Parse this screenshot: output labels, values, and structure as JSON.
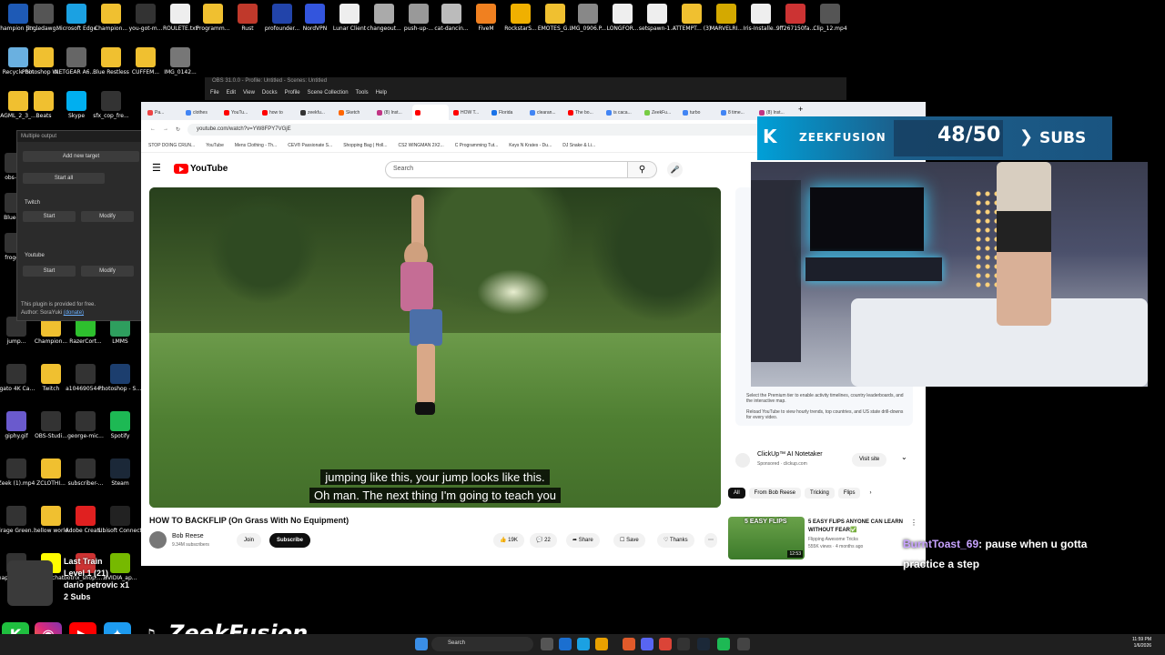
{
  "desktop": {
    "icons": [
      {
        "label": "Champion Stream Ov...",
        "color": "#1e5ab6"
      },
      {
        "label": "jingledawg...",
        "color": "#555"
      },
      {
        "label": "Microsoft Edge",
        "color": "#1ba1e2"
      },
      {
        "label": "Champion...",
        "color": "#f0c030"
      },
      {
        "label": "you-got-m...",
        "color": "#333"
      },
      {
        "label": "ROULETE.txt",
        "color": "#eee"
      },
      {
        "label": "Programm...",
        "color": "#f0c030"
      },
      {
        "label": "Rust",
        "color": "#c0392b"
      },
      {
        "label": "profounder...",
        "color": "#2244aa"
      },
      {
        "label": "NordVPN",
        "color": "#3355dd"
      },
      {
        "label": "Lunar Client",
        "color": "#eee"
      },
      {
        "label": "changeout...",
        "color": "#aaa"
      },
      {
        "label": "push-up-...",
        "color": "#999"
      },
      {
        "label": "cat-dancin...",
        "color": "#bbb"
      },
      {
        "label": "FiveM",
        "color": "#f08020"
      },
      {
        "label": "RockstarS...",
        "color": "#f0b000"
      },
      {
        "label": "EMOTES_G...",
        "color": "#f0c030"
      },
      {
        "label": "IMG_0906.P...",
        "color": "#888"
      },
      {
        "label": "LONGFOR...",
        "color": "#eee"
      },
      {
        "label": "setspawn-1...",
        "color": "#eee"
      },
      {
        "label": "ATTEMPT... (3)",
        "color": "#f0c030"
      },
      {
        "label": "MARVELRI...",
        "color": "#d4a900"
      },
      {
        "label": "Iris-Installe...",
        "color": "#eee"
      },
      {
        "label": "9ff267150fa...",
        "color": "#c33"
      },
      {
        "label": "Clip_12.mp4",
        "color": "#555"
      },
      {
        "label": "Recycle Bin",
        "color": "#6ab0e0"
      },
      {
        "label": "Photoshop Work",
        "color": "#f0c030"
      },
      {
        "label": "NETGEAR A6210 Genie",
        "color": "#666"
      },
      {
        "label": "Blue Restless",
        "color": "#f0c030"
      },
      {
        "label": "CUFFEM...",
        "color": "#f0c030"
      },
      {
        "label": "IMG_0142...",
        "color": "#777"
      },
      {
        "label": "AGML_2_3_...",
        "color": "#f0c030"
      },
      {
        "label": "Beats",
        "color": "#f0c030"
      },
      {
        "label": "Skype",
        "color": "#00aff0"
      },
      {
        "label": "sfx_cop_fre...",
        "color": "#333"
      },
      {
        "label": "obs-s...",
        "color": "#333"
      },
      {
        "label": "Blue-F...",
        "color": "#333"
      },
      {
        "label": "frogg...",
        "color": "#333"
      },
      {
        "label": "jump...",
        "color": "#333"
      },
      {
        "label": "Champion...",
        "color": "#f0c030"
      },
      {
        "label": "RazerCort...",
        "color": "#2ec02e"
      },
      {
        "label": "LMMS",
        "color": "#2e9e5e"
      },
      {
        "label": "Elgato 4K Captur...",
        "color": "#333"
      },
      {
        "label": "Twitch",
        "color": "#f0c030"
      },
      {
        "label": "a104690544...",
        "color": "#333"
      },
      {
        "label": "Photoshop - Shortcut",
        "color": "#1c3e6e"
      },
      {
        "label": "giphy.gif",
        "color": "#6a5acd"
      },
      {
        "label": "OBS-Studi...",
        "color": "#333"
      },
      {
        "label": "george-mic...",
        "color": "#333"
      },
      {
        "label": "Spotify",
        "color": "#1db954"
      },
      {
        "label": "Zeek (1).mp4",
        "color": "#333"
      },
      {
        "label": "ZCLOTHI...",
        "color": "#f0c030"
      },
      {
        "label": "subscriber-...",
        "color": "#333"
      },
      {
        "label": "Steam",
        "color": "#1b2838"
      },
      {
        "label": "Mirage Green Gaming Str...",
        "color": "#333"
      },
      {
        "label": "hellow world",
        "color": "#f0c030"
      },
      {
        "label": "Adobe Creati...",
        "color": "#e02020"
      },
      {
        "label": "Ubisoft Connect",
        "color": "#222"
      },
      {
        "label": "Snapchat botrix_shop...",
        "color": "#333"
      },
      {
        "label": "Snapchat",
        "color": "#fffc00"
      },
      {
        "label": "botrix_shop... PM.pdf",
        "color": "#c33"
      },
      {
        "label": "NVIDIA_ap...",
        "color": "#76b900"
      },
      {
        "label": "2024-04-15...",
        "color": "#555"
      },
      {
        "label": "Epic Games",
        "color": "#222"
      },
      {
        "label": "Invoice01.pdf",
        "color": "#c33"
      },
      {
        "label": "9f21ebb988...",
        "color": "#c33"
      },
      {
        "label": "NVIDIA App",
        "color": "#76b900"
      }
    ]
  },
  "multiple_output": {
    "title": "Multiple output",
    "add_target": "Add new target",
    "start_all": "Start all",
    "targets": [
      {
        "name": "Twitch",
        "start": "Start",
        "modify": "Modify"
      },
      {
        "name": "Youtube",
        "start": "Start",
        "modify": "Modify"
      }
    ],
    "note": "This plugin is provided for free.",
    "author": "Author: SoraYuki",
    "donate": "(donate)"
  },
  "obs": {
    "title": "OBS 31.0.0 - Profile: Untitled - Scenes: Untitled",
    "menu": [
      "File",
      "Edit",
      "View",
      "Docks",
      "Profile",
      "Scene Collection",
      "Tools",
      "Help"
    ]
  },
  "browser": {
    "tabs": [
      {
        "label": "Pa...",
        "color": "#e44"
      },
      {
        "label": "clothes",
        "color": "#4285f4"
      },
      {
        "label": "YouTu...",
        "color": "#f00"
      },
      {
        "label": "how to",
        "color": "#f00"
      },
      {
        "label": "zeekfu...",
        "color": "#333"
      },
      {
        "label": "Sketch",
        "color": "#f60"
      },
      {
        "label": "(8) Inst...",
        "color": "#c13584"
      },
      {
        "label": "",
        "color": "#f00"
      },
      {
        "label": "HOW T...",
        "color": "#f00"
      },
      {
        "label": "Florida",
        "color": "#1a73e8"
      },
      {
        "label": "clearan...",
        "color": "#4285f4"
      },
      {
        "label": "The bo...",
        "color": "#f00"
      },
      {
        "label": "is caca...",
        "color": "#4285f4"
      },
      {
        "label": "ZeekFu...",
        "color": "#7c4"
      },
      {
        "label": "turbo",
        "color": "#4285f4"
      },
      {
        "label": "8 time...",
        "color": "#4285f4"
      },
      {
        "label": "(8) Inst...",
        "color": "#c13584"
      }
    ],
    "url": "youtube.com/watch?v=YW8FPY7VGjE",
    "bookmarks": [
      "STOP DOING CRUN...",
      "YouTube",
      "Mens Clothing - Th...",
      "CEV® Passionate S...",
      "Shopping Bag | Holl...",
      "CS2 WINGMAN 2X2...",
      "C Programming Tut...",
      "Keys N Krates - Du...",
      "DJ Snake & Li..."
    ]
  },
  "youtube": {
    "logo": "YouTube",
    "search_placeholder": "Search",
    "captions": [
      "jumping like this, your jump looks like this.",
      "Oh man. The next thing I'm going to teach you"
    ],
    "video_title": "HOW TO BACKFLIP (On Grass With No Equipment)",
    "channel": "Bob Reese",
    "subscribers": "9.34M subscribers",
    "join": "Join",
    "subscribe": "Subscribe",
    "likes": "19K",
    "comments": "22",
    "share": "Share",
    "save": "Save",
    "thanks": "Thanks",
    "promo_lines": [
      "Select the Premium tier to enable activity timelines, country leaderboards, and the interactive map.",
      "Reload YouTube to view hourly trends, top countries, and US state drill-downs for every video."
    ],
    "ad_title": "ClickUp™ AI Notetaker",
    "ad_sponsor": "Sponsored · clickup.com",
    "ad_button": "Visit site",
    "chips": [
      "All",
      "From Bob Reese",
      "Tricking",
      "Flips"
    ],
    "rec": {
      "thumb_text": "5 EASY FLIPS",
      "duration": "12:53",
      "title": "5 EASY FLIPS ANYONE CAN LEARN WITHOUT FEAR✅",
      "channel": "Flipping Awesome Tricks",
      "views": "555K views · 4 months ago"
    }
  },
  "overlay": {
    "brand": "ZEEKFUSION",
    "sub_goal": "48/50",
    "sub_label": "SUBS",
    "chat": {
      "user": "BurntToast_69",
      "message": ": pause when u gotta practice a step"
    },
    "events": [
      "Last Train",
      "Level 1 (21)",
      "dario petrovic x1",
      "2 Subs"
    ],
    "handle": "ZeekFusion"
  },
  "taskbar": {
    "search": "Search",
    "time": "11:59 PM",
    "date": "1/6/2026"
  }
}
